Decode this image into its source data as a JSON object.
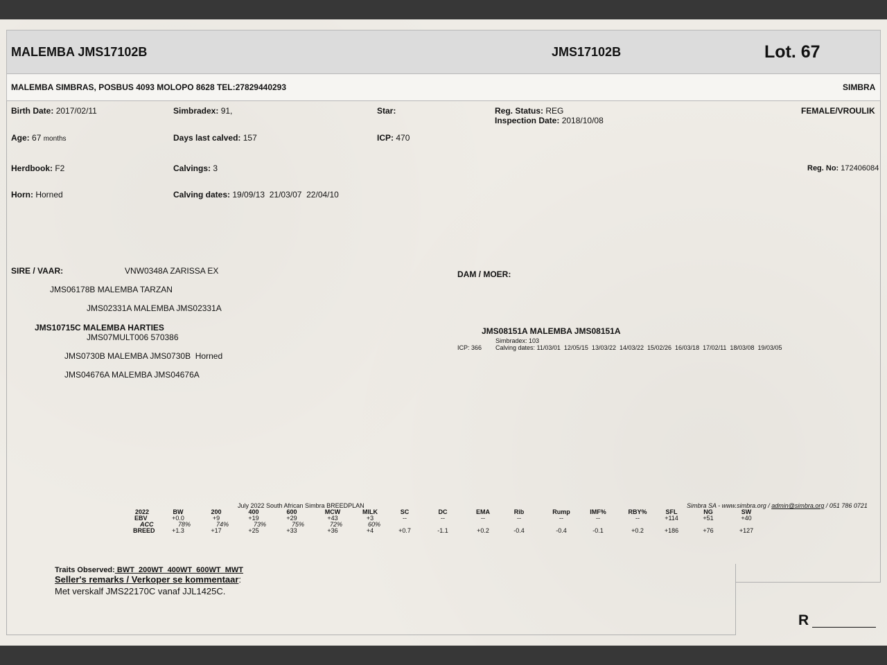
{
  "header": {
    "title": "MALEMBA JMS17102B",
    "id": "JMS17102B",
    "lot": "Lot. 67"
  },
  "breeder": {
    "address": "MALEMBA SIMBRAS, POSBUS 4093 MOLOPO 8628 TEL:27829440293",
    "breed": "SIMBRA"
  },
  "details": {
    "birth_date_label": "Birth Date:",
    "birth_date": "2017/02/11",
    "simbradex_label": "Simbradex:",
    "simbradex": "91,",
    "star_label": "Star:",
    "reg_status_label": "Reg. Status:",
    "reg_status": "REG",
    "inspection_label": "Inspection Date:",
    "inspection_date": "2018/10/08",
    "sex": "FEMALE/VROULIK",
    "age_label": "Age:",
    "age": "67",
    "age_unit": "months",
    "days_calved_label": "Days last calved:",
    "days_calved": "157",
    "icp_label": "ICP:",
    "icp": "470",
    "herdbook_label": "Herdbook:",
    "herdbook": "F2",
    "calvings_label": "Calvings:",
    "calvings": "3",
    "reg_no_label": "Reg. No:",
    "reg_no": "172406084",
    "horn_label": "Horn:",
    "horn": "Horned",
    "calving_dates_label": "Calving dates:",
    "calving_dates": "19/09/13  21/03/07  22/04/10"
  },
  "pedigree": {
    "sire_label": "SIRE / VAAR:",
    "sire_sire_sire": "VNW0348A ZARISSA EX",
    "sire_sire": "JMS06178B MALEMBA TARZAN",
    "sire_sire_dam": "JMS02331A MALEMBA JMS02331A",
    "sire": "JMS10715C MALEMBA HARTIES",
    "sire_extra": "JMS07MULT006 570386",
    "sire_dam_sire": "JMS0730B MALEMBA JMS0730B  Horned",
    "sire_dam": "JMS04676A MALEMBA JMS04676A",
    "dam_label": "DAM / MOER:",
    "dam": "JMS08151A MALEMBA JMS08151A",
    "dam_simbradex": "Simbradex: 103",
    "dam_icp": "ICP: 366",
    "dam_calving_dates": "Calving dates: 11/03/01  12/05/15  13/03/22  14/03/22  15/02/26  16/03/18  17/02/11  18/03/08  19/03/05"
  },
  "breedplan": {
    "title": "July 2022 South African Simbra BREEDPLAN",
    "contact_prefix": "Simbra SA - www.simbra.org / ",
    "contact_email": "admin@simbra.org",
    "contact_suffix": " / 051 786 0721",
    "year": "2022",
    "columns": [
      "BW",
      "200",
      "400",
      "600",
      "MCW",
      "MILK",
      "SC",
      "DC",
      "EMA",
      "Rib",
      "Rump",
      "IMF%",
      "RBY%",
      "SFL",
      "NG",
      "SW"
    ],
    "ebv_label": "EBV",
    "ebv": [
      "+0.0",
      "+9",
      "+19",
      "+29",
      "+43",
      "+3",
      "--",
      "--",
      "--",
      "--",
      "--",
      "--",
      "--",
      "+114",
      "+51",
      "+40"
    ],
    "acc_label": "ACC",
    "acc": [
      "78%",
      "74%",
      "73%",
      "75%",
      "72%",
      "60%"
    ],
    "breed_label": "BREED",
    "breed": [
      "+1.3",
      "+17",
      "+25",
      "+33",
      "+36",
      "+4",
      "+0.7",
      "-1.1",
      "+0.2",
      "-0.4",
      "-0.4",
      "-0.1",
      "+0.2",
      "+186",
      "+76",
      "+127"
    ]
  },
  "remarks": {
    "traits_label": "Traits Observed:",
    "traits": " BWT  200WT  400WT  600WT  MWT",
    "seller_label": "Seller's remarks / Verkoper se kommentaar",
    "seller_colon": ":",
    "text": "Met verskalf JMS22170C vanaf JJL1425C."
  },
  "price_label": "R"
}
